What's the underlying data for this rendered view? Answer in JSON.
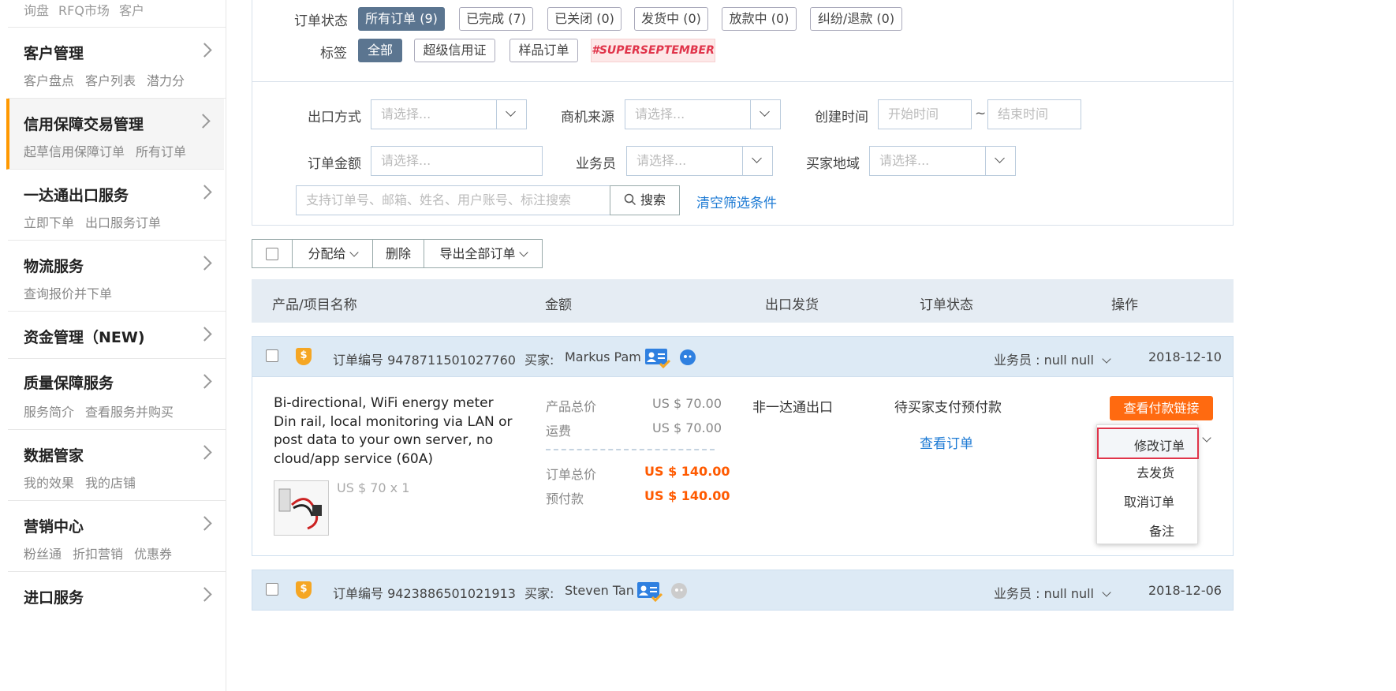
{
  "sidebar": {
    "top_links": [
      "询盘",
      "RFQ市场",
      "客户"
    ],
    "groups": [
      {
        "title": "客户管理",
        "subs": [
          "客户盘点",
          "客户列表",
          "潜力分"
        ]
      },
      {
        "title": "信用保障交易管理",
        "subs": [
          "起草信用保障订单",
          "所有订单"
        ]
      },
      {
        "title": "一达通出口服务",
        "subs": [
          "立即下单",
          "出口服务订单"
        ]
      },
      {
        "title": "物流服务",
        "subs": [
          "查询报价并下单"
        ]
      },
      {
        "title": "资金管理（NEW)",
        "subs": []
      },
      {
        "title": "质量保障服务",
        "subs": [
          "服务简介",
          "查看服务并购买"
        ]
      },
      {
        "title": "数据管家",
        "subs": [
          "我的效果",
          "我的店铺"
        ]
      },
      {
        "title": "营销中心",
        "subs": [
          "粉丝通",
          "折扣营销",
          "优惠券"
        ]
      },
      {
        "title": "进口服务",
        "subs": []
      }
    ]
  },
  "filters": {
    "status_label": "订单状态",
    "status_tabs": [
      "所有订单 (9)",
      "已完成 (7)",
      "已关闭 (0)",
      "发货中 (0)",
      "放款中 (0)",
      "纠纷/退款 (0)"
    ],
    "tag_label": "标签",
    "tags": [
      "全部",
      "超级信用证",
      "样品订单"
    ],
    "promo": "#SUPERSEPTEMBER",
    "export_label": "出口方式",
    "source_label": "商机来源",
    "created_label": "创建时间",
    "amount_label": "订单金额",
    "sales_label": "业务员",
    "region_label": "买家地域",
    "select_placeholder": "请选择...",
    "start_time": "开始时间",
    "end_time": "结束时间",
    "tilde": "~",
    "search_placeholder": "支持订单号、邮箱、姓名、用户账号、标注搜索",
    "search_button": "搜索",
    "clear_link": "清空筛选条件"
  },
  "toolbar": {
    "assign": "分配给",
    "delete": "删除",
    "export_all": "导出全部订单"
  },
  "table_headers": [
    "产品/项目名称",
    "金额",
    "出口发货",
    "订单状态",
    "操作"
  ],
  "orders": [
    {
      "order_no": "订单编号 9478711501027760",
      "buyer_label": "买家:",
      "buyer": "Markus Pam",
      "salesperson": "业务员 : null null",
      "date": "2018-12-10",
      "product_name": "Bi-directional, WiFi energy meter Din rail, local monitoring via LAN or post data to your own server, no cloud/app service (60A)",
      "unit_price": "US $ 70 x 1",
      "product_total_label": "产品总价",
      "product_total": "US $ 70.00",
      "shipping_label": "运费",
      "shipping": "US $ 70.00",
      "order_total_label": "订单总价",
      "order_total": "US $ 140.00",
      "prepay_label": "预付款",
      "prepay": "US $ 140.00",
      "export": "非一达通出口",
      "status": "待买家支付预付款",
      "view_order": "查看订单",
      "pay_link_btn": "查看付款链接",
      "actions": [
        "修改订单",
        "去发货",
        "取消订单",
        "备注"
      ]
    },
    {
      "order_no": "订单编号 9423886501021913",
      "buyer_label": "买家:",
      "buyer": "Steven Tan",
      "salesperson": "业务员 : null null",
      "date": "2018-12-06"
    }
  ],
  "colors": {
    "accent_orange": "#ff6a10",
    "link_blue": "#1c7ad4",
    "highlight_red": "#e0344a"
  }
}
